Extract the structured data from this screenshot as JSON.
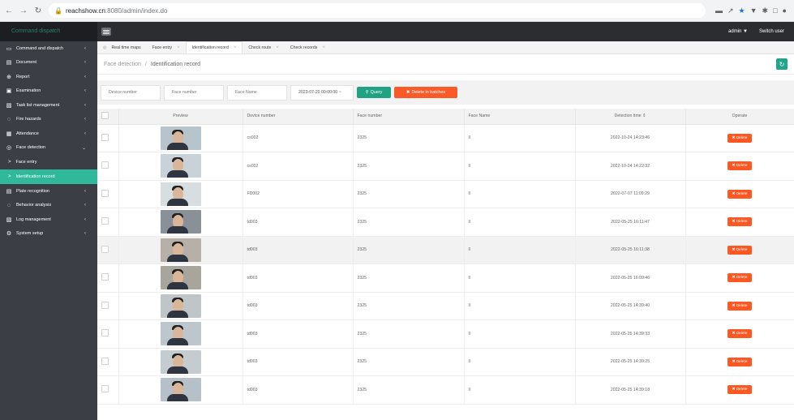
{
  "browser": {
    "url_host": "reachshow.cn",
    "url_path": ":8080/admin/index.do"
  },
  "topbar": {
    "app_title": "Command dispatch",
    "user": "admin",
    "switch_user": "Switch user"
  },
  "sidebar": {
    "items": [
      {
        "label": "Command and dispatch",
        "icon": "monitor-icon"
      },
      {
        "label": "Document",
        "icon": "folder-icon"
      },
      {
        "label": "Report",
        "icon": "report-icon"
      },
      {
        "label": "Examination",
        "icon": "exam-icon"
      },
      {
        "label": "Task list management",
        "icon": "task-icon"
      },
      {
        "label": "Fire hazards",
        "icon": "fire-icon"
      },
      {
        "label": "Attendance",
        "icon": "attendance-icon"
      },
      {
        "label": "Face detection",
        "icon": "face-icon"
      }
    ],
    "sub_items": [
      {
        "label": "Face entry"
      },
      {
        "label": "Identification record"
      }
    ],
    "items_after": [
      {
        "label": "Plate recognition",
        "icon": "plate-icon"
      },
      {
        "label": "Behavior analysis",
        "icon": "behavior-icon"
      },
      {
        "label": "Log management",
        "icon": "log-icon"
      },
      {
        "label": "System setup",
        "icon": "gear-icon"
      }
    ]
  },
  "tabs": [
    {
      "label": "Real time maps"
    },
    {
      "label": "Face entry"
    },
    {
      "label": "Identification record"
    },
    {
      "label": "Check route"
    },
    {
      "label": "Check records"
    }
  ],
  "breadcrumb": {
    "parent": "Face detection",
    "sep": "/",
    "current": "Identification record"
  },
  "filters": {
    "device_number_placeholder": "Device number",
    "face_number_placeholder": "Face number",
    "face_name_placeholder": "Face Name",
    "date_value": "2023-07-20 00:00:00 ~",
    "query_label": "Query",
    "delete_batch_label": "Delete in batches"
  },
  "table": {
    "headers": {
      "preview": "Preview",
      "device_number": "Device number",
      "face_number": "Face number",
      "face_name": "Face Name",
      "detection_time": "Detection time",
      "operate": "Operate"
    },
    "delete_label": "Delete",
    "rows": [
      {
        "device": "cs002",
        "face_number": "2325",
        "face_name": "ll",
        "time": "2022-10-24 14:23:46"
      },
      {
        "device": "cs002",
        "face_number": "2325",
        "face_name": "ll",
        "time": "2022-10-24 14:22:32"
      },
      {
        "device": "FD002",
        "face_number": "2325",
        "face_name": "ll",
        "time": "2022-07-07 11:09:29"
      },
      {
        "device": "td003",
        "face_number": "2325",
        "face_name": "ll",
        "time": "2022-05-25 16:11:47"
      },
      {
        "device": "td003",
        "face_number": "2325",
        "face_name": "ll",
        "time": "2022-05-25 16:11:38"
      },
      {
        "device": "td003",
        "face_number": "2325",
        "face_name": "ll",
        "time": "2022-05-25 16:09:46"
      },
      {
        "device": "td003",
        "face_number": "2325",
        "face_name": "ll",
        "time": "2022-05-25 14:39:40"
      },
      {
        "device": "td003",
        "face_number": "2325",
        "face_name": "ll",
        "time": "2022-05-25 14:39:33"
      },
      {
        "device": "td003",
        "face_number": "2325",
        "face_name": "ll",
        "time": "2022-05-25 14:39:25"
      },
      {
        "device": "td003",
        "face_number": "2325",
        "face_name": "ll",
        "time": "2022-05-25 14:39:18"
      }
    ]
  }
}
